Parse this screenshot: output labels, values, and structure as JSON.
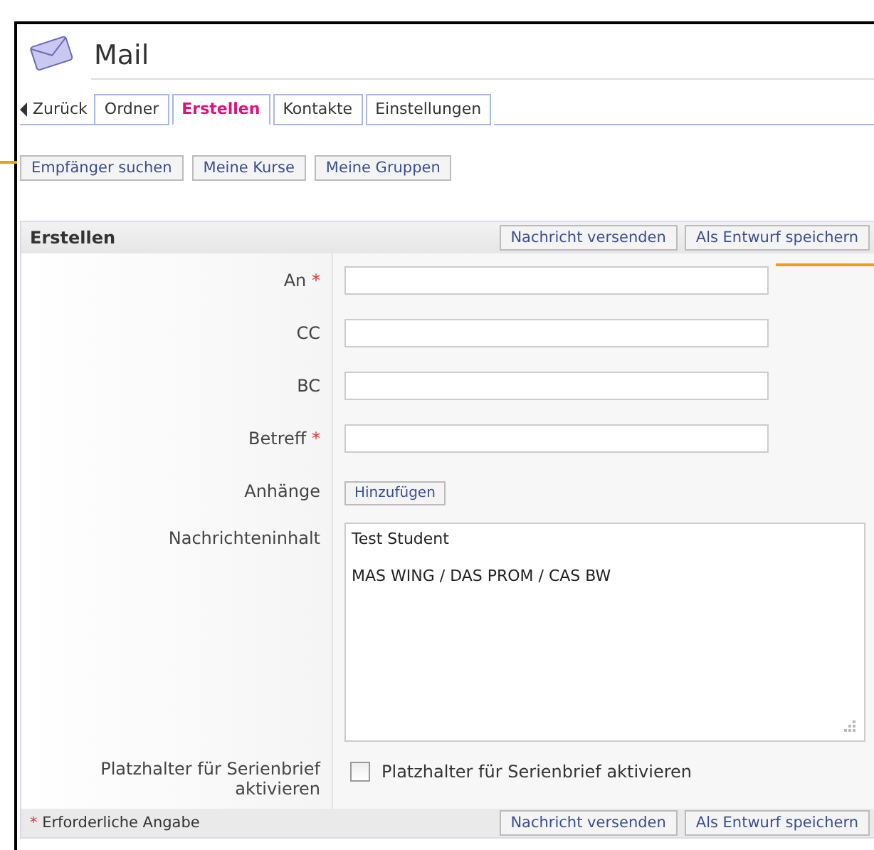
{
  "window": {
    "title": "Mail"
  },
  "back": {
    "label": "Zurück"
  },
  "tabs": [
    {
      "label": "Ordner",
      "selected": false
    },
    {
      "label": "Erstellen",
      "selected": true
    },
    {
      "label": "Kontakte",
      "selected": false
    },
    {
      "label": "Einstellungen",
      "selected": false
    }
  ],
  "toolbar": [
    "Empfänger suchen",
    "Meine Kurse",
    "Meine Gruppen"
  ],
  "form": {
    "title": "Erstellen",
    "actions": [
      "Nachricht versenden",
      "Als Entwurf speichern"
    ],
    "fields": [
      {
        "kind": "text",
        "label": "An",
        "required": true
      },
      {
        "kind": "text",
        "label": "CC",
        "required": false
      },
      {
        "kind": "text",
        "label": "BC",
        "required": false
      },
      {
        "kind": "text",
        "label": "Betreff",
        "required": true
      },
      {
        "kind": "button",
        "label": "Anhänge",
        "required": false,
        "button": "Hinzufügen"
      },
      {
        "kind": "textarea",
        "label": "Nachrichteninhalt",
        "required": false,
        "lines": [
          "Test Student",
          "MAS WING / DAS PROM / CAS BW"
        ]
      },
      {
        "kind": "checkbox",
        "label": "Platzhalter für Serienbrief aktivieren",
        "required": false,
        "checked": false,
        "text": "Platzhalter für Serienbrief aktivieren"
      }
    ],
    "footer": {
      "mark": "*",
      "note": "Erforderliche Angabe",
      "actions": [
        "Nachricht versenden",
        "Als Entwurf speichern"
      ]
    }
  }
}
